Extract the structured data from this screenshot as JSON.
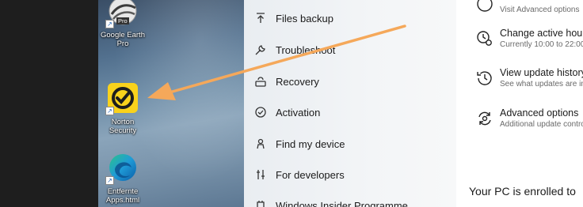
{
  "colors": {
    "arrow": "#f5a85a",
    "norton_yellow": "#f9d21c"
  },
  "desktop": {
    "icons": [
      {
        "label_line1": "Google Earth",
        "label_line2": "Pro",
        "badge": "Pro",
        "icon": "google-earth-icon"
      },
      {
        "label_line1": "Norton",
        "label_line2": "Security",
        "icon": "norton-icon"
      },
      {
        "label_line1": "Entfernte",
        "label_line2": "Apps.html",
        "icon": "edge-icon"
      }
    ]
  },
  "settings_menu": {
    "items": [
      {
        "label": "Files backup",
        "icon": "backup-arrow-icon"
      },
      {
        "label": "Troubleshoot",
        "icon": "wrench-icon"
      },
      {
        "label": "Recovery",
        "icon": "recovery-icon"
      },
      {
        "label": "Activation",
        "icon": "check-circle-icon"
      },
      {
        "label": "Find my device",
        "icon": "person-pin-icon"
      },
      {
        "label": "For developers",
        "icon": "developer-tools-icon"
      },
      {
        "label": "Windows Insider Programme",
        "icon": "insider-icon"
      }
    ]
  },
  "update_options": {
    "items": [
      {
        "title": "",
        "subtitle": "Visit Advanced options",
        "icon": "pause-icon"
      },
      {
        "title": "Change active hours",
        "subtitle": "Currently 10:00 to 22:00",
        "icon": "clock-gear-icon"
      },
      {
        "title": "View update history",
        "subtitle": "See what updates are installed",
        "icon": "history-icon"
      },
      {
        "title": "Advanced options",
        "subtitle": "Additional update controls",
        "icon": "advanced-sync-icon"
      }
    ],
    "enrolled_text": "Your PC is enrolled to"
  }
}
